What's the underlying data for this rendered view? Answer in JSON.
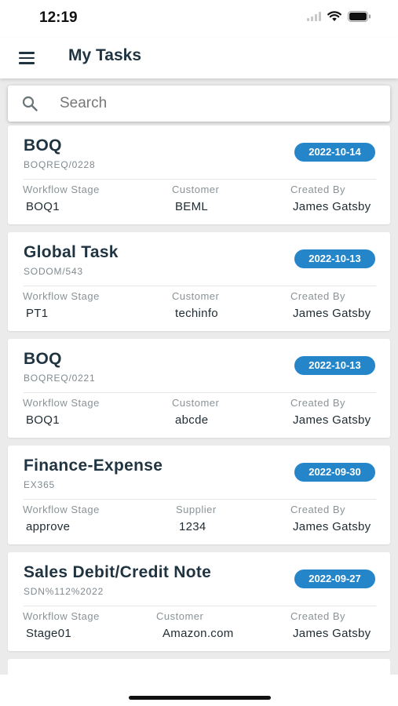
{
  "status_bar": {
    "time": "12:19"
  },
  "header": {
    "title": "My Tasks"
  },
  "search": {
    "placeholder": "Search"
  },
  "colors": {
    "accent": "#2585c9",
    "title_text": "#1f3440",
    "background": "#ebebeb"
  },
  "tasks": [
    {
      "title": "BOQ",
      "ref": "BOQREQ/0228",
      "date": "2022-10-14",
      "fields": [
        {
          "label": "Workflow Stage",
          "value": "BOQ1"
        },
        {
          "label": "Customer",
          "value": "BEML"
        },
        {
          "label": "Created By",
          "value": "James Gatsby"
        }
      ]
    },
    {
      "title": "Global Task",
      "ref": "SODOM/543",
      "date": "2022-10-13",
      "fields": [
        {
          "label": "Workflow Stage",
          "value": "PT1"
        },
        {
          "label": "Customer",
          "value": "techinfo"
        },
        {
          "label": "Created By",
          "value": "James Gatsby"
        }
      ]
    },
    {
      "title": "BOQ",
      "ref": "BOQREQ/0221",
      "date": "2022-10-13",
      "fields": [
        {
          "label": "Workflow Stage",
          "value": "BOQ1"
        },
        {
          "label": "Customer",
          "value": "abcde"
        },
        {
          "label": "Created By",
          "value": "James Gatsby"
        }
      ]
    },
    {
      "title": "Finance-Expense",
      "ref": "EX365",
      "date": "2022-09-30",
      "fields": [
        {
          "label": "Workflow Stage",
          "value": "approve"
        },
        {
          "label": "Supplier",
          "value": "1234"
        },
        {
          "label": "Created By",
          "value": "James Gatsby"
        }
      ]
    },
    {
      "title": "Sales Debit/Credit Note",
      "ref": "SDN%112%2022",
      "date": "2022-09-27",
      "fields": [
        {
          "label": "Workflow Stage",
          "value": "Stage01"
        },
        {
          "label": "Customer",
          "value": "Amazon.com"
        },
        {
          "label": "Created By",
          "value": "James Gatsby"
        }
      ]
    }
  ]
}
